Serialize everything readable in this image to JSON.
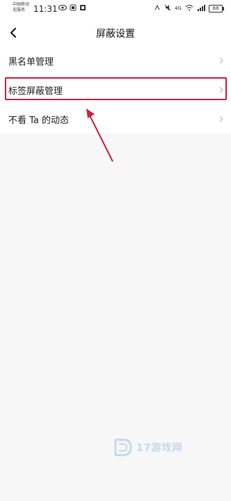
{
  "status_bar": {
    "carrier_line1": "中国移动",
    "carrier_line2": "无服务",
    "time": "11:31",
    "battery": "88"
  },
  "header": {
    "title": "屏蔽设置"
  },
  "settings_list": {
    "items": [
      {
        "label": "黑名单管理"
      },
      {
        "label": "标签屏蔽管理"
      },
      {
        "label": "不看 Ta 的动态"
      }
    ]
  },
  "watermark": {
    "text": "17游戏网"
  },
  "colors": {
    "highlight": "#c9223d",
    "background": "#f7f7f7",
    "watermark": "#6aa2d8"
  }
}
